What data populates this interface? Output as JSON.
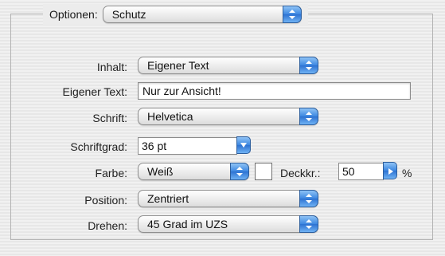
{
  "options": {
    "label": "Optionen:",
    "value": "Schutz"
  },
  "rows": {
    "inhalt": {
      "label": "Inhalt:",
      "value": "Eigener Text"
    },
    "eigener_text": {
      "label": "Eigener Text:",
      "value": "Nur zur Ansicht!"
    },
    "schrift": {
      "label": "Schrift:",
      "value": "Helvetica"
    },
    "schriftgrad": {
      "label": "Schriftgrad:",
      "value": "36 pt"
    },
    "farbe": {
      "label": "Farbe:",
      "value": "Weiß",
      "swatch_color": "#ffffff"
    },
    "deckkraft": {
      "label": "Deckkr.:",
      "value": "50",
      "unit": "%"
    },
    "position": {
      "label": "Position:",
      "value": "Zentriert"
    },
    "drehen": {
      "label": "Drehen:",
      "value": "45 Grad im UZS"
    }
  },
  "icons": {
    "popup_arrows": "up-down-arrows-icon",
    "combo_arrow": "down-arrow-icon",
    "stepper_arrow": "right-arrow-icon"
  },
  "colors": {
    "accent": "#3b86e0"
  }
}
